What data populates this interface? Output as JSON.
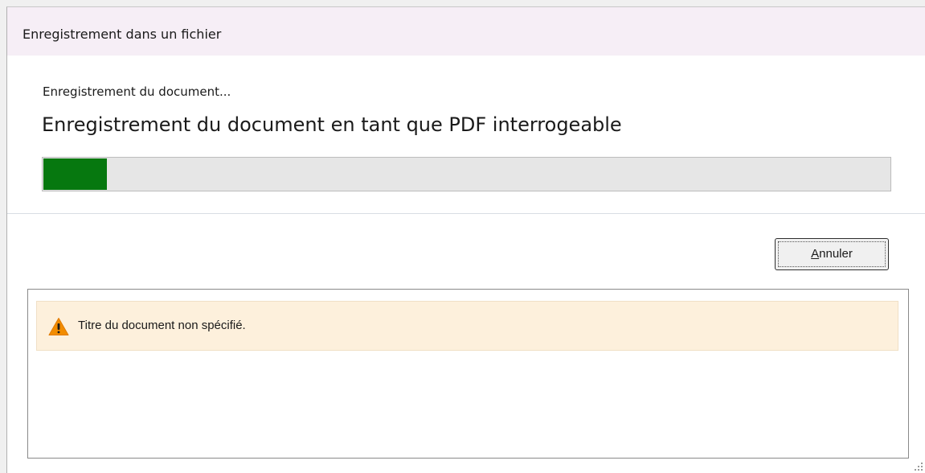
{
  "window": {
    "title": "Enregistrement dans un fichier"
  },
  "status": {
    "heading": "Enregistrement du document...",
    "detail": "Enregistrement du document en tant que PDF interrogeable"
  },
  "progress": {
    "percent": 7.5,
    "fill_color": "#06780f"
  },
  "actions": {
    "cancel_label_mnemonic": "A",
    "cancel_label_rest": "nnuler"
  },
  "messages": [
    {
      "type": "warning",
      "icon": "warning-triangle-icon",
      "text": "Titre du document non spécifié."
    }
  ],
  "colors": {
    "warning_background": "#fdf0dc",
    "warning_icon": "#f28c00"
  }
}
